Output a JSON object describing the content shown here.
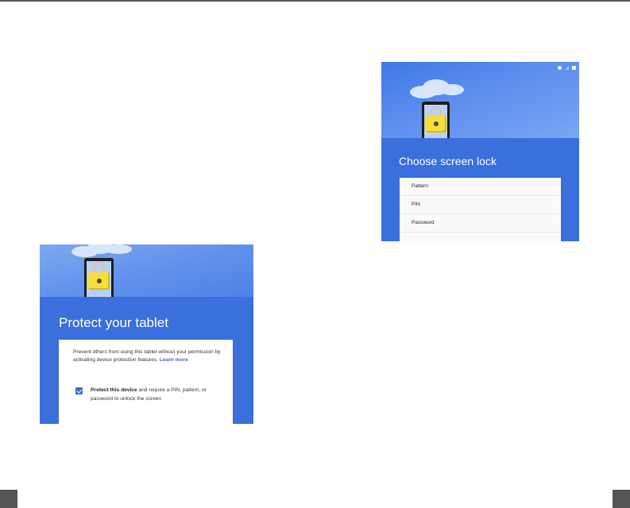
{
  "left_screen": {
    "title": "Protect your tablet",
    "description": "Prevent others from using this tablet without your permission by activating device protection features.",
    "learn_more": "Learn more",
    "checkbox_checked": true,
    "checkbox_bold": "Protect this device",
    "checkbox_rest": " and require a PIN, pattern, or password to unlock the screen"
  },
  "right_screen": {
    "title": "Choose screen lock",
    "options": [
      "Pattern",
      "PIN",
      "Password"
    ]
  },
  "colors": {
    "band_blue": "#3a6fdc",
    "lock_yellow": "#f6de3a",
    "checkbox_blue": "#3b6fd6",
    "link_blue": "#3367d6"
  }
}
